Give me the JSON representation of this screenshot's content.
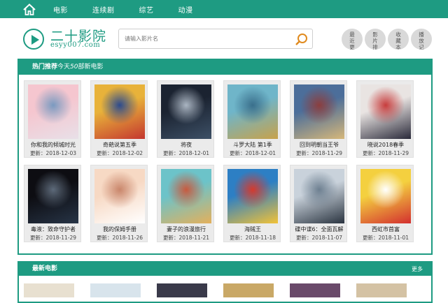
{
  "nav": {
    "items": [
      {
        "label": "电影"
      },
      {
        "label": "连续剧"
      },
      {
        "label": "综艺"
      },
      {
        "label": "动漫"
      }
    ]
  },
  "logo": {
    "title": "二十影院",
    "subtitle": "esyy007.com"
  },
  "search": {
    "placeholder": "请输入影片名"
  },
  "quick_buttons": [
    {
      "label": "最近更新"
    },
    {
      "label": "影片排行"
    },
    {
      "label": "收藏本站"
    },
    {
      "label": "播放记录"
    }
  ],
  "hot": {
    "title": "热门推荐",
    "today": "今天",
    "count": "50",
    "unit": "部新电影"
  },
  "movies": [
    {
      "title": "你和我的倾城时光",
      "date": "更新：2018-12-03",
      "colors": [
        "#f5c6cf",
        "#e8e0e8",
        "#7a9ac0"
      ]
    },
    {
      "title": "奇葩说第五季",
      "date": "更新：2018-12-02",
      "colors": [
        "#e8b23a",
        "#c4362f",
        "#2c4a8e"
      ]
    },
    {
      "title": "将夜",
      "date": "更新：2018-12-01",
      "colors": [
        "#1b2331",
        "#3d5066",
        "#aab5c2"
      ]
    },
    {
      "title": "斗罗大陆 第1季",
      "date": "更新：2018-12-01",
      "colors": [
        "#6fb5c9",
        "#c8a24a",
        "#3a6f8c"
      ]
    },
    {
      "title": "回到明朝当王爷",
      "date": "更新：2018-11-29",
      "colors": [
        "#4c6e9a",
        "#d6b77a",
        "#8c3e3e"
      ]
    },
    {
      "title": "晓说2018春季",
      "date": "更新：2018-11-29",
      "colors": [
        "#e9e4e2",
        "#2a2a3a",
        "#c73c3c"
      ]
    },
    {
      "title": "毒液：致命守护者",
      "date": "更新：2018-11-29",
      "colors": [
        "#0d0d12",
        "#273446",
        "#5d6a7a"
      ]
    },
    {
      "title": "我的保姆手册",
      "date": "更新：2018-11-26",
      "colors": [
        "#f7d9c4",
        "#ffffff",
        "#c9866b"
      ]
    },
    {
      "title": "妻子的浪漫旅行",
      "date": "更新：2018-11-21",
      "colors": [
        "#6cc3c9",
        "#e4b05b",
        "#c85a3e"
      ]
    },
    {
      "title": "海贼王",
      "date": "更新：2018-11-18",
      "colors": [
        "#2d7fc4",
        "#f2c237",
        "#d63a2c"
      ]
    },
    {
      "title": "碟中谍6：全面瓦解",
      "date": "更新：2018-11-07",
      "colors": [
        "#c9d2db",
        "#2a3440",
        "#6d7f90"
      ]
    },
    {
      "title": "西虹市首富",
      "date": "更新：2018-11-01",
      "colors": [
        "#f4d03f",
        "#d32f2f",
        "#ffffff"
      ]
    }
  ],
  "latest": {
    "title": "最新电影",
    "more": "更多"
  },
  "accent": "#1e9b82"
}
